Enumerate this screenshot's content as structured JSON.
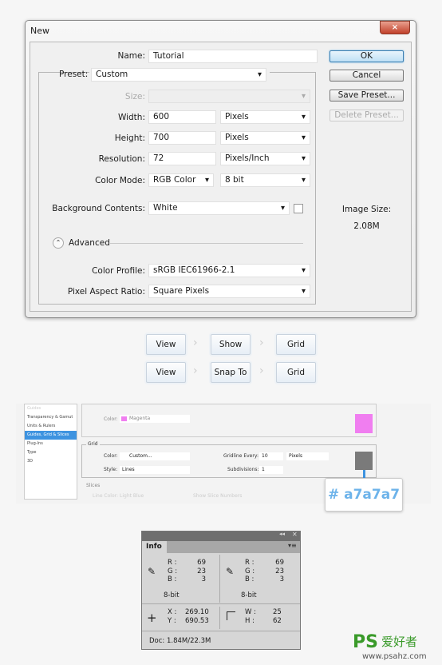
{
  "dialog": {
    "title": "New",
    "close": "×",
    "name_label": "Name:",
    "name_value": "Tutorial",
    "preset_label": "Preset:",
    "preset_value": "Custom",
    "size_label": "Size:",
    "width_label": "Width:",
    "width_value": "600",
    "width_unit": "Pixels",
    "height_label": "Height:",
    "height_value": "700",
    "height_unit": "Pixels",
    "resolution_label": "Resolution:",
    "resolution_value": "72",
    "resolution_unit": "Pixels/Inch",
    "color_mode_label": "Color Mode:",
    "color_mode_value": "RGB Color",
    "bit_depth": "8 bit",
    "bg_label": "Background Contents:",
    "bg_value": "White",
    "advanced_label": "Advanced",
    "profile_label": "Color Profile:",
    "profile_value": "sRGB IEC61966-2.1",
    "par_label": "Pixel Aspect Ratio:",
    "par_value": "Square Pixels",
    "ok": "OK",
    "cancel": "Cancel",
    "save_preset": "Save Preset...",
    "delete_preset": "Delete Preset...",
    "image_size_label": "Image Size:",
    "image_size_value": "2.08M"
  },
  "menu_paths": [
    [
      "View",
      "Show",
      "Grid"
    ],
    [
      "View",
      "Snap To",
      "Grid"
    ]
  ],
  "preferences": {
    "sidebar": [
      "Guides",
      "Transparency & Gamut",
      "Units & Rulers",
      "Guides, Grid & Slices",
      "Plug-Ins",
      "Type",
      "3D"
    ],
    "selected_index": 3,
    "guide_color_label": "Color:",
    "guide_color_value": "Magenta",
    "guide_swatch": "#f07ef0",
    "grid_title": "Grid",
    "grid_color_label": "Color:",
    "grid_color_value": "Custom...",
    "style_label": "Style:",
    "style_value": "Lines",
    "gridline_label": "Gridline Every:",
    "gridline_value": "10",
    "gridline_unit": "Pixels",
    "subdiv_label": "Subdivisions:",
    "subdiv_value": "1",
    "grid_swatch": "#7a7a7a",
    "slices_title": "Slices",
    "line_color_label": "Line Color:",
    "line_color_value": "Light Blue",
    "show_slice_numbers": "Show Slice Numbers",
    "hex_callout": "# a7a7a7"
  },
  "info": {
    "tab": "Info",
    "left": {
      "r": "69",
      "g": "23",
      "b": "3",
      "depth": "8-bit"
    },
    "right": {
      "r": "69",
      "g": "23",
      "b": "3",
      "depth": "8-bit"
    },
    "x": "269.10",
    "y": "690.53",
    "w": "25",
    "h": "62",
    "doc": "Doc: 1.84M/22.3M",
    "labels": {
      "r": "R :",
      "g": "G :",
      "b": "B :",
      "x": "X :",
      "y": "Y :",
      "w": "W :",
      "h": "H :"
    }
  },
  "watermark": {
    "logo": "PS 爱好者",
    "url": "www.psahz.com"
  }
}
